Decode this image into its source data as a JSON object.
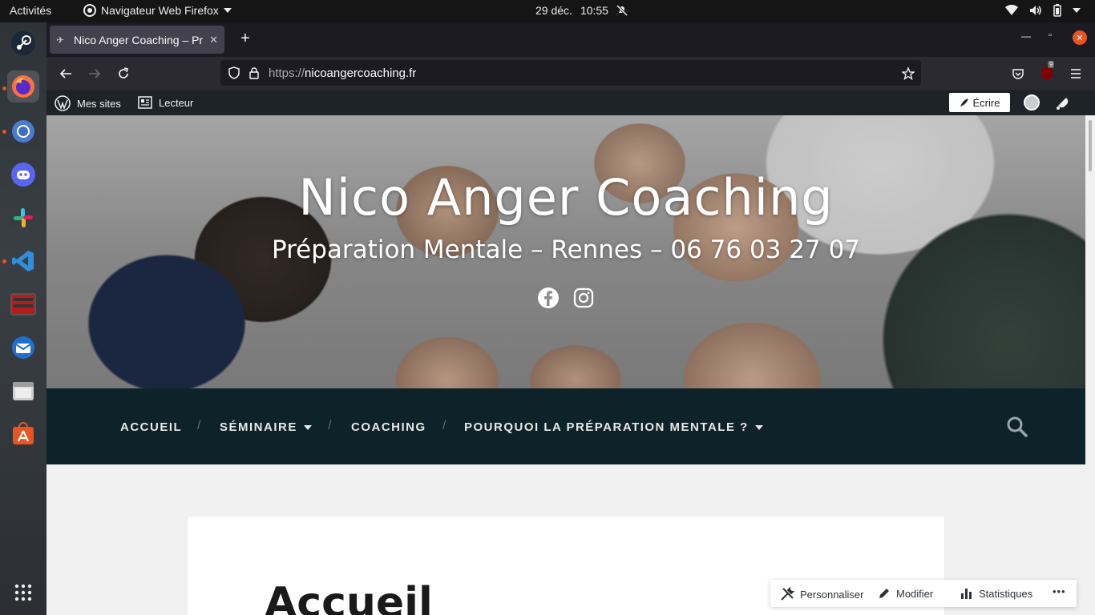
{
  "system": {
    "activities": "Activités",
    "app_name": "Navigateur Web Firefox",
    "date": "29 déc.",
    "time": "10:55"
  },
  "dock": [
    "steam-icon",
    "firefox-icon",
    "chrome-icon",
    "discord-icon",
    "slack-icon",
    "vscode-icon",
    "terminal-icon",
    "thunderbird-icon",
    "files-icon",
    "software-icon",
    "app-grid-icon"
  ],
  "browser": {
    "tab_title": "Nico Anger Coaching – Pr",
    "url_proto": "https://",
    "url_host": "nicoangercoaching.fr",
    "ublock_count": "9"
  },
  "wp_admin": {
    "mes_sites": "Mes sites",
    "lecteur": "Lecteur",
    "ecrire": "Écrire"
  },
  "site": {
    "title": "Nico Anger Coaching",
    "description": "Préparation Mentale – Rennes – 06 76 03 27 07",
    "nav": [
      {
        "label": "ACCUEIL"
      },
      {
        "label": "SÉMINAIRE"
      },
      {
        "label": "COACHING"
      },
      {
        "label": "POURQUOI LA PRÉPARATION MENTALE ?"
      }
    ],
    "nav_sep": "/",
    "page_title": "Accueil"
  },
  "customizer": {
    "personnaliser": "Personnaliser",
    "modifier": "Modifier",
    "statistiques": "Statistiques",
    "more": "•••"
  },
  "colors": {
    "nav_bg": "#0e2329",
    "accent": "#e95420",
    "wpbar_bg": "#1d2327"
  }
}
